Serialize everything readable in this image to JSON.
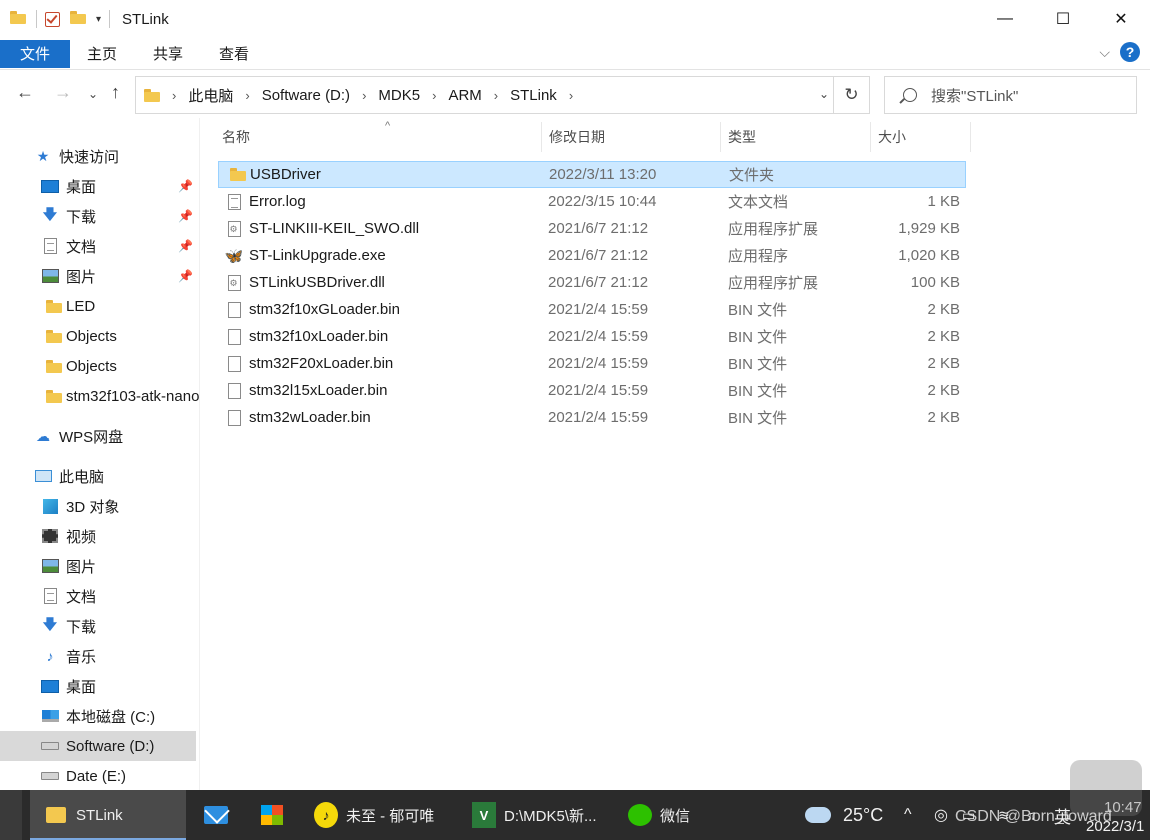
{
  "window": {
    "title": "STLink",
    "quick_access": [
      "folder-icon",
      "properties-check-icon",
      "new-folder-icon",
      "customize-dropdown-icon"
    ],
    "controls": {
      "minimize": "—",
      "maximize": "☐",
      "close": "✕"
    }
  },
  "ribbon": {
    "tabs": [
      "文件",
      "主页",
      "共享",
      "查看"
    ],
    "help": "?"
  },
  "address": {
    "breadcrumbs": [
      "此电脑",
      "Software (D:)",
      "MDK5",
      "ARM",
      "STLink"
    ],
    "search_placeholder": "搜索\"STLink\""
  },
  "sidebar": {
    "quick_access_label": "快速访问",
    "quick_items": [
      {
        "label": "桌面",
        "icon": "desktop-icon",
        "pinned": true
      },
      {
        "label": "下载",
        "icon": "download-icon",
        "pinned": true
      },
      {
        "label": "文档",
        "icon": "documents-icon",
        "pinned": true
      },
      {
        "label": "图片",
        "icon": "pictures-icon",
        "pinned": true
      },
      {
        "label": "LED",
        "icon": "folder-icon",
        "pinned": false
      },
      {
        "label": "Objects",
        "icon": "folder-icon",
        "pinned": false
      },
      {
        "label": "Objects",
        "icon": "folder-icon",
        "pinned": false
      },
      {
        "label": "stm32f103-atk-nano",
        "icon": "folder-icon",
        "pinned": false
      }
    ],
    "wps_label": "WPS网盘",
    "pc_label": "此电脑",
    "pc_items": [
      {
        "label": "3D 对象",
        "icon": "3d-objects-icon"
      },
      {
        "label": "视频",
        "icon": "videos-icon"
      },
      {
        "label": "图片",
        "icon": "pictures-icon"
      },
      {
        "label": "文档",
        "icon": "documents-icon"
      },
      {
        "label": "下载",
        "icon": "download-icon"
      },
      {
        "label": "音乐",
        "icon": "music-icon"
      },
      {
        "label": "桌面",
        "icon": "desktop-icon"
      },
      {
        "label": "本地磁盘 (C:)",
        "icon": "system-drive-icon"
      },
      {
        "label": "Software (D:)",
        "icon": "drive-icon"
      },
      {
        "label": "Date (E:)",
        "icon": "drive-icon"
      }
    ]
  },
  "columns": {
    "name": "名称",
    "date": "修改日期",
    "type": "类型",
    "size": "大小"
  },
  "files": [
    {
      "name": "USBDriver",
      "date": "2022/3/11 13:20",
      "type": "文件夹",
      "size": "",
      "icon": "folder-icon"
    },
    {
      "name": "Error.log",
      "date": "2022/3/15 10:44",
      "type": "文本文档",
      "size": "1 KB",
      "icon": "text-file-icon"
    },
    {
      "name": "ST-LINKIII-KEIL_SWO.dll",
      "date": "2021/6/7 21:12",
      "type": "应用程序扩展",
      "size": "1,929 KB",
      "icon": "dll-icon"
    },
    {
      "name": "ST-LinkUpgrade.exe",
      "date": "2021/6/7 21:12",
      "type": "应用程序",
      "size": "1,020 KB",
      "icon": "exe-icon"
    },
    {
      "name": "STLinkUSBDriver.dll",
      "date": "2021/6/7 21:12",
      "type": "应用程序扩展",
      "size": "100 KB",
      "icon": "dll-icon"
    },
    {
      "name": "stm32f10xGLoader.bin",
      "date": "2021/2/4 15:59",
      "type": "BIN 文件",
      "size": "2 KB",
      "icon": "file-icon"
    },
    {
      "name": "stm32f10xLoader.bin",
      "date": "2021/2/4 15:59",
      "type": "BIN 文件",
      "size": "2 KB",
      "icon": "file-icon"
    },
    {
      "name": "stm32F20xLoader.bin",
      "date": "2021/2/4 15:59",
      "type": "BIN 文件",
      "size": "2 KB",
      "icon": "file-icon"
    },
    {
      "name": "stm32l15xLoader.bin",
      "date": "2021/2/4 15:59",
      "type": "BIN 文件",
      "size": "2 KB",
      "icon": "file-icon"
    },
    {
      "name": "stm32wLoader.bin",
      "date": "2021/2/4 15:59",
      "type": "BIN 文件",
      "size": "2 KB",
      "icon": "file-icon"
    }
  ],
  "taskbar": {
    "apps": [
      {
        "label": "STLink",
        "icon": "file-explorer-icon",
        "active": true
      },
      {
        "label": "",
        "icon": "mail-icon",
        "active": false
      },
      {
        "label": "",
        "icon": "store-icon",
        "active": false
      },
      {
        "label": "未至 - 郁可唯",
        "icon": "music-player-icon",
        "active": false
      },
      {
        "label": "D:\\MDK5\\新...",
        "icon": "keil-icon",
        "active": false
      },
      {
        "label": "微信",
        "icon": "wechat-icon",
        "active": false
      }
    ],
    "weather": "25°C",
    "ime": "英",
    "time": "10:47",
    "date": "2022/3/1",
    "watermark": "CSDN @Born_toward"
  }
}
